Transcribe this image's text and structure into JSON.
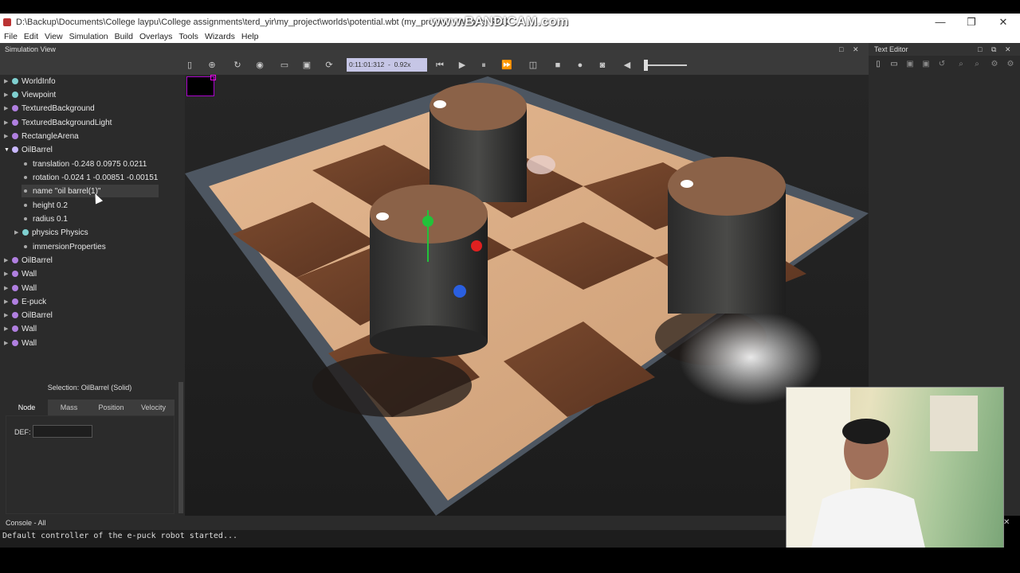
{
  "window": {
    "title": "D:\\Backup\\Documents\\College laypu\\College assignments\\terd_yir\\my_project\\worlds\\potential.wbt (my_project) - Webots R202",
    "watermark": "www.BANDICAM.com",
    "minimize": "—",
    "restore": "❐",
    "close": "✕"
  },
  "menu": [
    "File",
    "Edit",
    "View",
    "Simulation",
    "Build",
    "Overlays",
    "Tools",
    "Wizards",
    "Help"
  ],
  "simulation_view": {
    "title": "Simulation View",
    "time": "0:11:01:312",
    "speed": "0.92x",
    "float_icon": "□",
    "close_icon": "✕"
  },
  "scene_tree": {
    "nodes": [
      {
        "label": "WorldInfo",
        "color": "#7fd0d0",
        "expanded": false
      },
      {
        "label": "Viewpoint",
        "color": "#7fd0d0",
        "expanded": false
      },
      {
        "label": "TexturedBackground",
        "color": "#b07fe0",
        "expanded": false
      },
      {
        "label": "TexturedBackgroundLight",
        "color": "#b07fe0",
        "expanded": false
      },
      {
        "label": "RectangleArena",
        "color": "#b07fe0",
        "expanded": false
      },
      {
        "label": "OilBarrel",
        "color": "#b07fe0",
        "expanded": true,
        "selected": true
      }
    ],
    "fields": [
      {
        "label": "translation -0.248 0.0975 0.0211"
      },
      {
        "label": "rotation -0.024 1 -0.00851 -0.00151"
      },
      {
        "label": "name \"oil barrel(1)\""
      },
      {
        "label": "height 0.2"
      },
      {
        "label": "radius 0.1"
      },
      {
        "label": "physics Physics",
        "expandable": true
      },
      {
        "label": "immersionProperties"
      }
    ],
    "after_nodes": [
      {
        "label": "OilBarrel"
      },
      {
        "label": "Wall"
      },
      {
        "label": "Wall"
      },
      {
        "label": "E-puck"
      },
      {
        "label": "OilBarrel"
      },
      {
        "label": "Wall"
      },
      {
        "label": "Wall"
      }
    ]
  },
  "field_editor": {
    "selection": "Selection: OilBarrel (Solid)",
    "tabs": [
      "Node",
      "Mass",
      "Position",
      "Velocity"
    ],
    "active_tab": "Node",
    "def_label": "DEF:",
    "def_value": ""
  },
  "text_editor": {
    "title": "Text Editor"
  },
  "console": {
    "title": "Console - All",
    "line": "Default controller of the e-puck robot started...",
    "close_icon": "✕"
  },
  "colors": {
    "panel_bg": "#2b2b2b",
    "selection": "#8b7cf0",
    "timefield": "#c6c6e6"
  }
}
